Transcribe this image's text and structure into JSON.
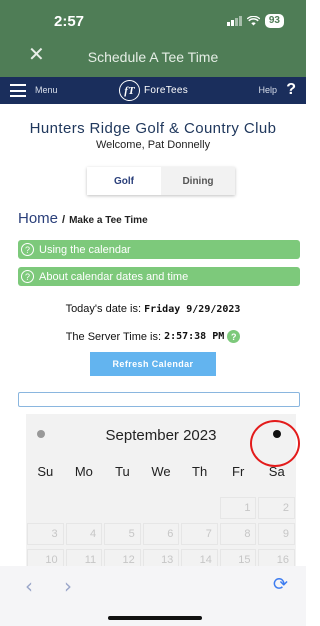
{
  "status_bar": {
    "time": "2:57",
    "battery": "93"
  },
  "nav": {
    "close_icon": "close-icon",
    "title": "Schedule A Tee Time"
  },
  "menubar": {
    "menu_label": "Menu",
    "logo_mark": "fT",
    "logo_text": "ForeTees",
    "help_label": "Help",
    "help_glyph": "?"
  },
  "club": {
    "name": "Hunters Ridge Golf & Country Club",
    "welcome": "Welcome, Pat Donnelly"
  },
  "tabs": [
    {
      "label": "Golf",
      "active": true
    },
    {
      "label": "Dining",
      "active": false
    }
  ],
  "breadcrumb": {
    "home": "Home",
    "separator": "/",
    "current": "Make a Tee Time"
  },
  "info": {
    "using_calendar": "Using the calendar",
    "about_dates": "About calendar dates and time",
    "glyph": "?"
  },
  "dates": {
    "today_label": "Today's date is:",
    "today_value": "Friday 9/29/2023",
    "server_label": "The Server Time is:",
    "server_value": "2:57:38 PM"
  },
  "refresh_label": "Refresh Calendar",
  "calendar": {
    "month_title": "September 2023",
    "weekdays": [
      "Su",
      "Mo",
      "Tu",
      "We",
      "Th",
      "Fr",
      "Sa"
    ],
    "weeks": [
      [
        "",
        "",
        "",
        "",
        "",
        "1",
        "2"
      ],
      [
        "3",
        "4",
        "5",
        "6",
        "7",
        "8",
        "9"
      ],
      [
        "10",
        "11",
        "12",
        "13",
        "14",
        "15",
        "16"
      ]
    ]
  },
  "colors": {
    "header_green": "#4f7d56",
    "menubar_navy": "#1a2e5c",
    "info_green": "#7dc97b",
    "refresh_blue": "#63b4ef",
    "highlight_red": "#e31b1b"
  },
  "toolbar": {
    "back": "‹",
    "forward": "›",
    "reload": "⟳"
  }
}
